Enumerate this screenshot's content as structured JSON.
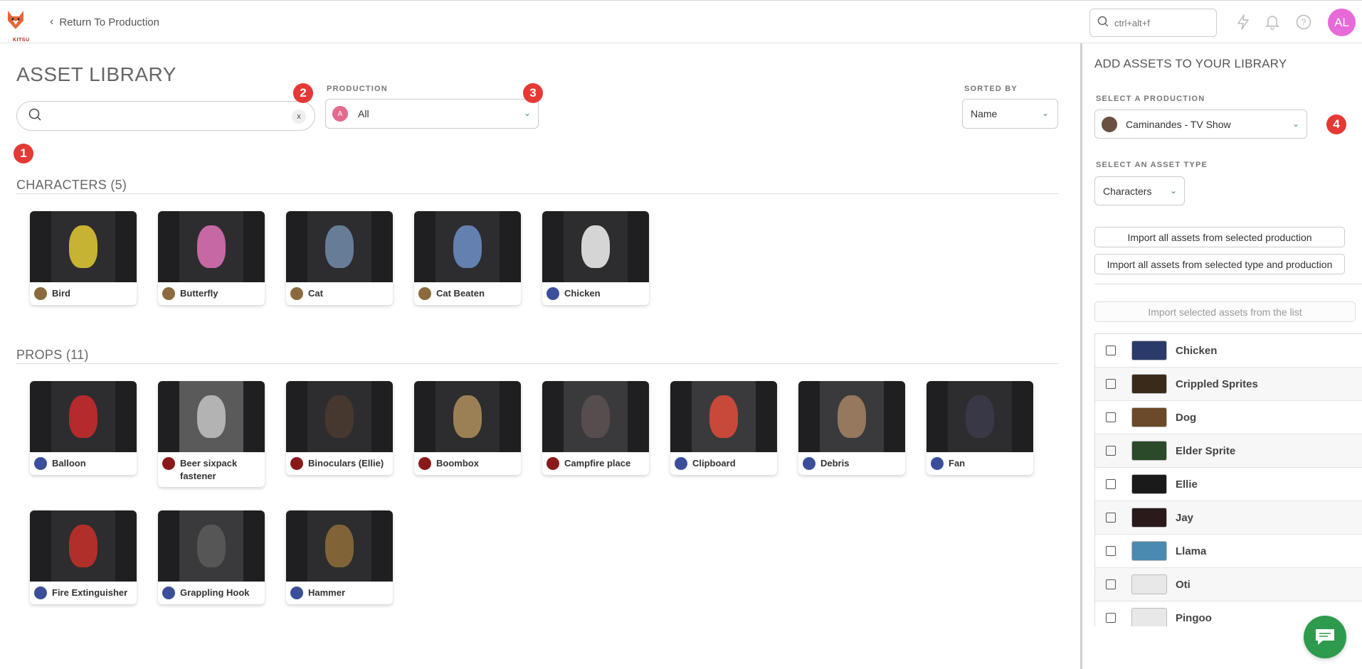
{
  "header": {
    "logo_text": "KITSU",
    "back_label": "Return To Production",
    "search_placeholder": "ctrl+alt+f",
    "avatar_initials": "AL",
    "avatar_color": "#e76ad9"
  },
  "main": {
    "title": "ASSET LIBRARY",
    "search_clear": "x",
    "production_label": "PRODUCTION",
    "production_value": "All",
    "production_initial": "A",
    "sorted_label": "SORTED BY",
    "sorted_value": "Name",
    "badges": [
      "1",
      "2",
      "3",
      "4"
    ],
    "sections": [
      {
        "title": "CHARACTERS (5)",
        "items": [
          {
            "name": "Bird",
            "thumb": "#2d2d2f",
            "accent": "#d8c233",
            "pic": "#8a6a3e"
          },
          {
            "name": "Butterfly",
            "thumb": "#2d2d2f",
            "accent": "#d66fb0",
            "pic": "#8a6a3e"
          },
          {
            "name": "Cat",
            "thumb": "#2d2d2f",
            "accent": "#6e86a3",
            "pic": "#8a6a3e"
          },
          {
            "name": "Cat Beaten",
            "thumb": "#2d2d2f",
            "accent": "#6a8ac0",
            "pic": "#8a6a3e"
          },
          {
            "name": "Chicken",
            "thumb": "#2d2d2f",
            "accent": "#e8e8e8",
            "pic": "#3a4f9a"
          }
        ]
      },
      {
        "title": "PROPS (11)",
        "items": [
          {
            "name": "Balloon",
            "thumb": "#2d2d2f",
            "accent": "#c42a2a",
            "pic": "#3a4f9a"
          },
          {
            "name": "Beer sixpack fastener",
            "thumb": "#5a5a5a",
            "accent": "#bdbdbd",
            "pic": "#8a1a1a"
          },
          {
            "name": "Binoculars (Ellie)",
            "thumb": "#2d2d2f",
            "accent": "#4a3a30",
            "pic": "#8a1a1a"
          },
          {
            "name": "Boombox",
            "thumb": "#2d2d2f",
            "accent": "#a88a5a",
            "pic": "#8a1a1a"
          },
          {
            "name": "Campfire place",
            "thumb": "#3a3a3c",
            "accent": "#5a5050",
            "pic": "#8a1a1a"
          },
          {
            "name": "Clipboard",
            "thumb": "#3a3a3c",
            "accent": "#d84a3a",
            "pic": "#3a4f9a"
          },
          {
            "name": "Debris",
            "thumb": "#3a3a3c",
            "accent": "#a08060",
            "pic": "#3a4f9a"
          },
          {
            "name": "Fan",
            "thumb": "#2d2d2f",
            "accent": "#3a3a4a",
            "pic": "#3a4f9a"
          },
          {
            "name": "Fire Extinguisher",
            "thumb": "#2d2d2f",
            "accent": "#c0302a",
            "pic": "#3a4f9a"
          },
          {
            "name": "Grappling Hook",
            "thumb": "#3a3a3c",
            "accent": "#5a5a5a",
            "pic": "#3a4f9a"
          },
          {
            "name": "Hammer",
            "thumb": "#2d2d2f",
            "accent": "#8a6a3a",
            "pic": "#3a4f9a"
          }
        ]
      }
    ]
  },
  "panel": {
    "title": "ADD ASSETS TO YOUR LIBRARY",
    "select_production_label": "SELECT A PRODUCTION",
    "production_value": "Caminandes - TV Show",
    "select_type_label": "SELECT AN ASSET TYPE",
    "type_value": "Characters",
    "import_all_label": "Import all assets from selected production",
    "import_type_label": "Import all assets from selected type and production",
    "import_selected_label": "Import selected assets from the list",
    "assets": [
      {
        "name": "Chicken",
        "thumb": "#2a3a6a"
      },
      {
        "name": "Crippled Sprites",
        "thumb": "#3a2a1a"
      },
      {
        "name": "Dog",
        "thumb": "#6a4a2a"
      },
      {
        "name": "Elder Sprite",
        "thumb": "#2a4a2a"
      },
      {
        "name": "Ellie",
        "thumb": "#1a1a1a"
      },
      {
        "name": "Jay",
        "thumb": "#2a1a1a"
      },
      {
        "name": "Llama",
        "thumb": "#4a8ab0"
      },
      {
        "name": "Oti",
        "thumb": "#e8e8e8"
      },
      {
        "name": "Pingoo",
        "thumb": "#e8e8e8"
      }
    ]
  }
}
